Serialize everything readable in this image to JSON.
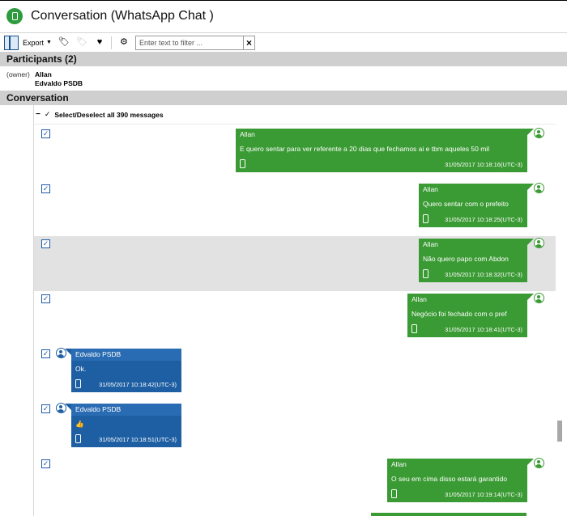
{
  "window": {
    "title": "Conversation (WhatsApp Chat )"
  },
  "toolbar": {
    "export_label": "Export",
    "filter_placeholder": "Enter text to filter ...",
    "clear_symbol": "×"
  },
  "participants": {
    "header": "Participants (2)",
    "owner_tag": "(owner)",
    "names": [
      "Allan",
      "Edvaldo PSDB"
    ]
  },
  "conversation": {
    "header": "Conversation",
    "select_all_label": "Select/Deselect all 390 messages",
    "messages": [
      {
        "sender": "Allan",
        "text": "E quero sentar para ver referente a 20 dias que fechamos ai e tbm aqueles 50 mil",
        "timestamp": "31/05/2017 10:18:16(UTC-3)",
        "checked": true
      },
      {
        "sender": "Allan",
        "text": "Quero sentar com o prefeito",
        "timestamp": "31/05/2017 10:18:25(UTC-3)",
        "checked": true
      },
      {
        "sender": "Allan",
        "text": "Não quero papo com Abdon",
        "timestamp": "31/05/2017 10:18:32(UTC-3)",
        "checked": true
      },
      {
        "sender": "Allan",
        "text": "Negócio foi fechado com o pref",
        "timestamp": "31/05/2017 10:18:41(UTC-3)",
        "checked": true
      },
      {
        "sender": "Edvaldo PSDB",
        "text": "Ok.",
        "timestamp": "31/05/2017 10:18:42(UTC-3)",
        "checked": true
      },
      {
        "sender": "Edvaldo PSDB",
        "text": "👍",
        "timestamp": "31/05/2017 10:18:51(UTC-3)",
        "checked": true
      },
      {
        "sender": "Allan",
        "text": "O seu em cima disso estará garantido",
        "timestamp": "31/05/2017 10:19:14(UTC-3)",
        "checked": true
      }
    ]
  },
  "colors": {
    "outgoing": "#3a9a33",
    "incoming": "#1e5fa3",
    "checkbox": "#1e5aa8",
    "section_header": "#cfcfcf"
  },
  "icons": [
    "panel-toggle-icon",
    "tag-icon",
    "untag-icon",
    "heart-tag-icon",
    "gear-icon",
    "phone-icon",
    "avatar-icon"
  ]
}
